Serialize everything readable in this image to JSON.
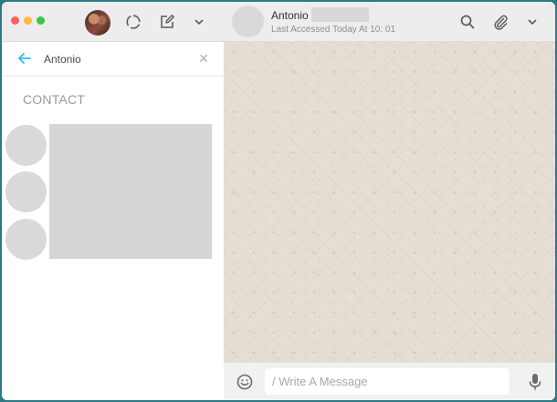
{
  "sidebar": {
    "search": {
      "query": "Antonio"
    },
    "section_label": "CONTACT"
  },
  "chat": {
    "contact_name": "Antonio",
    "last_seen": "Last Accessed Today At 10: 01",
    "composer": {
      "placeholder": "/ Write A Message"
    }
  },
  "icons": {
    "header_left": [
      "status-icon",
      "new-chat-icon",
      "chevron-down-icon"
    ],
    "header_right": [
      "search-icon",
      "paperclip-icon",
      "chevron-down-icon"
    ]
  },
  "colors": {
    "accent": "#34b7f1",
    "traffic_red": "#fc605c",
    "traffic_yellow": "#fdbc40",
    "traffic_green": "#34c84a",
    "chat_background": "#e6ddd4"
  }
}
